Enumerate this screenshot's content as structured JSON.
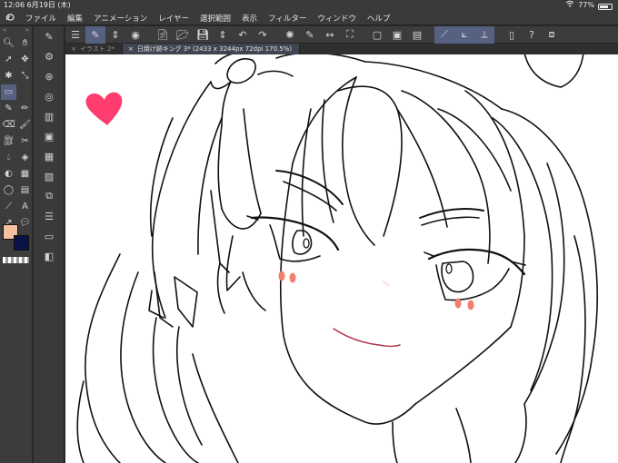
{
  "status": {
    "time": "12:06",
    "date": "6月19日 (木)",
    "battery": "77%",
    "battery_fill": 0.77
  },
  "menu": [
    "ファイル",
    "編集",
    "アニメーション",
    "レイヤー",
    "選択範囲",
    "表示",
    "フィルター",
    "ウィンドウ",
    "ヘルプ"
  ],
  "tabs": [
    {
      "label": "イラスト 2*",
      "active": false
    },
    {
      "label": "日焼け跡キング 3* (2433 x 3244px 72dpi 170.5%)",
      "active": true
    }
  ],
  "colors": {
    "main": "#f6c0a0",
    "sub": "#0b1247",
    "accent": "#566081",
    "heart": "#ff3d6e",
    "blush": "#f0806a",
    "mouth": "#b0304a"
  },
  "icons": {
    "app": "clip-studio-logo",
    "wifi": "wifi-icon",
    "battery": "battery-icon"
  }
}
